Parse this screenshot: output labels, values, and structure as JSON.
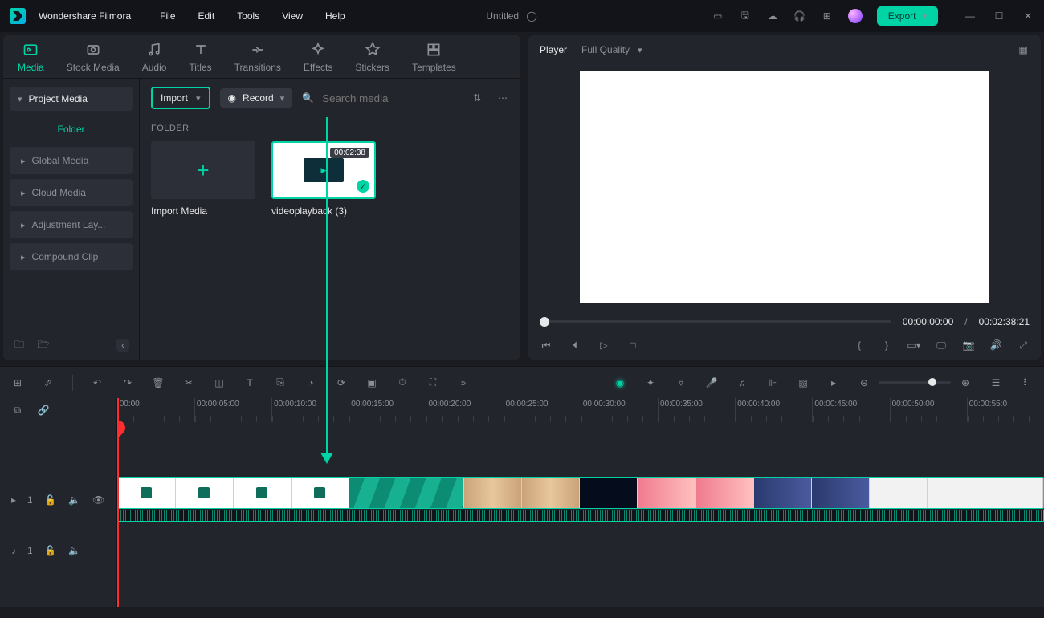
{
  "app": {
    "name": "Wondershare Filmora"
  },
  "menu": [
    "File",
    "Edit",
    "Tools",
    "View",
    "Help"
  ],
  "document": {
    "title": "Untitled"
  },
  "export_label": "Export",
  "tabs": [
    {
      "label": "Media",
      "active": true
    },
    {
      "label": "Stock Media"
    },
    {
      "label": "Audio"
    },
    {
      "label": "Titles"
    },
    {
      "label": "Transitions"
    },
    {
      "label": "Effects"
    },
    {
      "label": "Stickers"
    },
    {
      "label": "Templates"
    }
  ],
  "sidebar": {
    "project_media": "Project Media",
    "folder": "Folder",
    "items": [
      "Global Media",
      "Cloud Media",
      "Adjustment Lay...",
      "Compound Clip"
    ]
  },
  "toolbar": {
    "import": "Import",
    "record": "Record",
    "search_placeholder": "Search media",
    "folder_label": "FOLDER",
    "import_media": "Import Media",
    "clip_name": "videoplayback (3)",
    "clip_duration": "00:02:38"
  },
  "player": {
    "label": "Player",
    "quality": "Full Quality",
    "current": "00:00:00:00",
    "total": "00:02:38:21",
    "separator": "/"
  },
  "ruler": [
    "00:00",
    "00:00:05:00",
    "00:00:10:00",
    "00:00:15:00",
    "00:00:20:00",
    "00:00:25:00",
    "00:00:30:00",
    "00:00:35:00",
    "00:00:40:00",
    "00:00:45:00",
    "00:00:50:00",
    "00:00:55:0"
  ],
  "tracks": {
    "video": "1",
    "audio": "1"
  }
}
